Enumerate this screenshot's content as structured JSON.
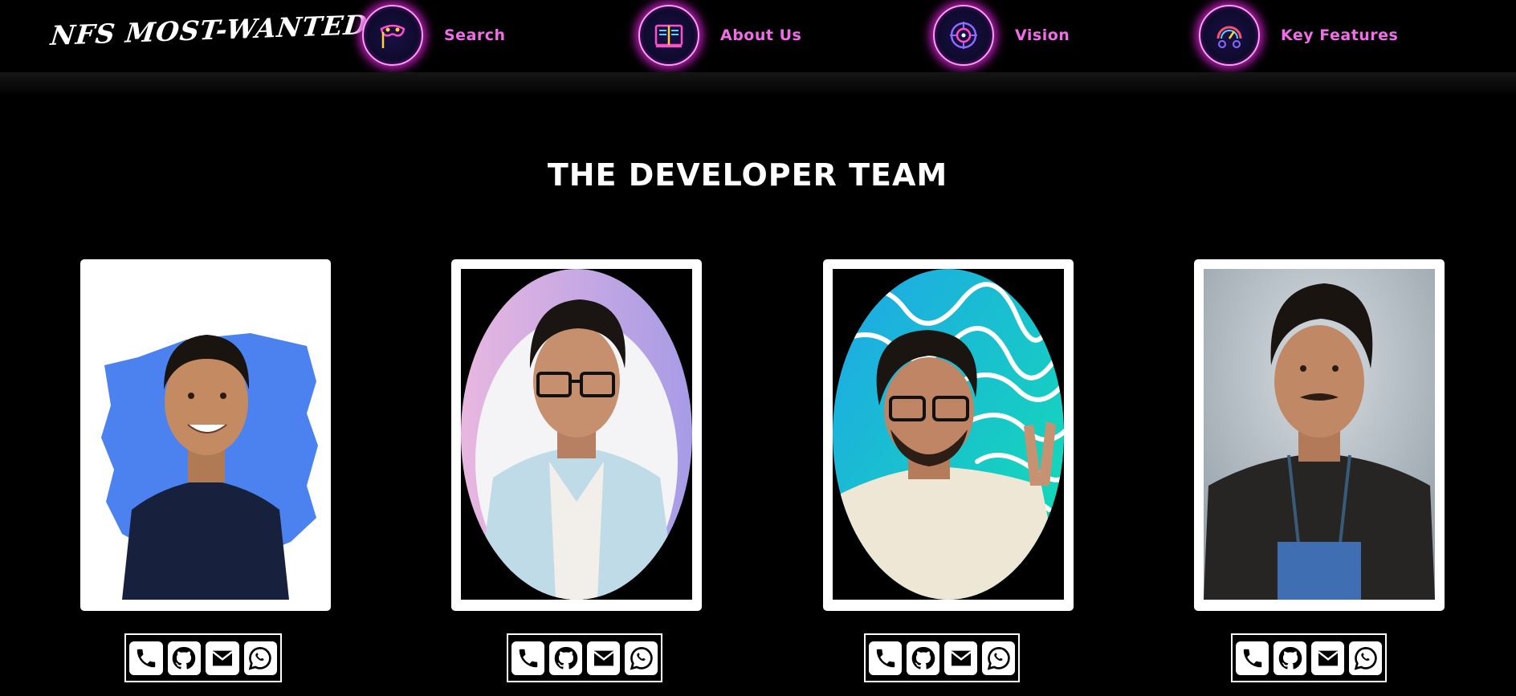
{
  "navbar": {
    "logo_text": "NFS MOST-WANTED",
    "items": [
      {
        "label": "Search",
        "icon": "mask-icon"
      },
      {
        "label": "About Us",
        "icon": "book-icon"
      },
      {
        "label": "Vision",
        "icon": "target-icon"
      },
      {
        "label": "Key Features",
        "icon": "speedometer-icon"
      }
    ]
  },
  "section": {
    "title": "THE DEVELOPER TEAM"
  },
  "team": {
    "members": [
      {
        "photo": "developer-photo-1",
        "contacts": [
          "phone-icon",
          "github-icon",
          "mail-icon",
          "whatsapp-icon"
        ]
      },
      {
        "photo": "developer-photo-2",
        "contacts": [
          "phone-icon",
          "github-icon",
          "mail-icon",
          "whatsapp-icon"
        ]
      },
      {
        "photo": "developer-photo-3",
        "contacts": [
          "phone-icon",
          "github-icon",
          "mail-icon",
          "whatsapp-icon"
        ]
      },
      {
        "photo": "developer-photo-4",
        "contacts": [
          "phone-icon",
          "github-icon",
          "mail-icon",
          "whatsapp-icon"
        ]
      }
    ]
  },
  "colors": {
    "background": "#000000",
    "nav_label": "#f06ce8",
    "nav_glow": "#c21fbe",
    "title": "#ffffff",
    "card": "#ffffff",
    "accent_blue": "#4b82f0"
  }
}
